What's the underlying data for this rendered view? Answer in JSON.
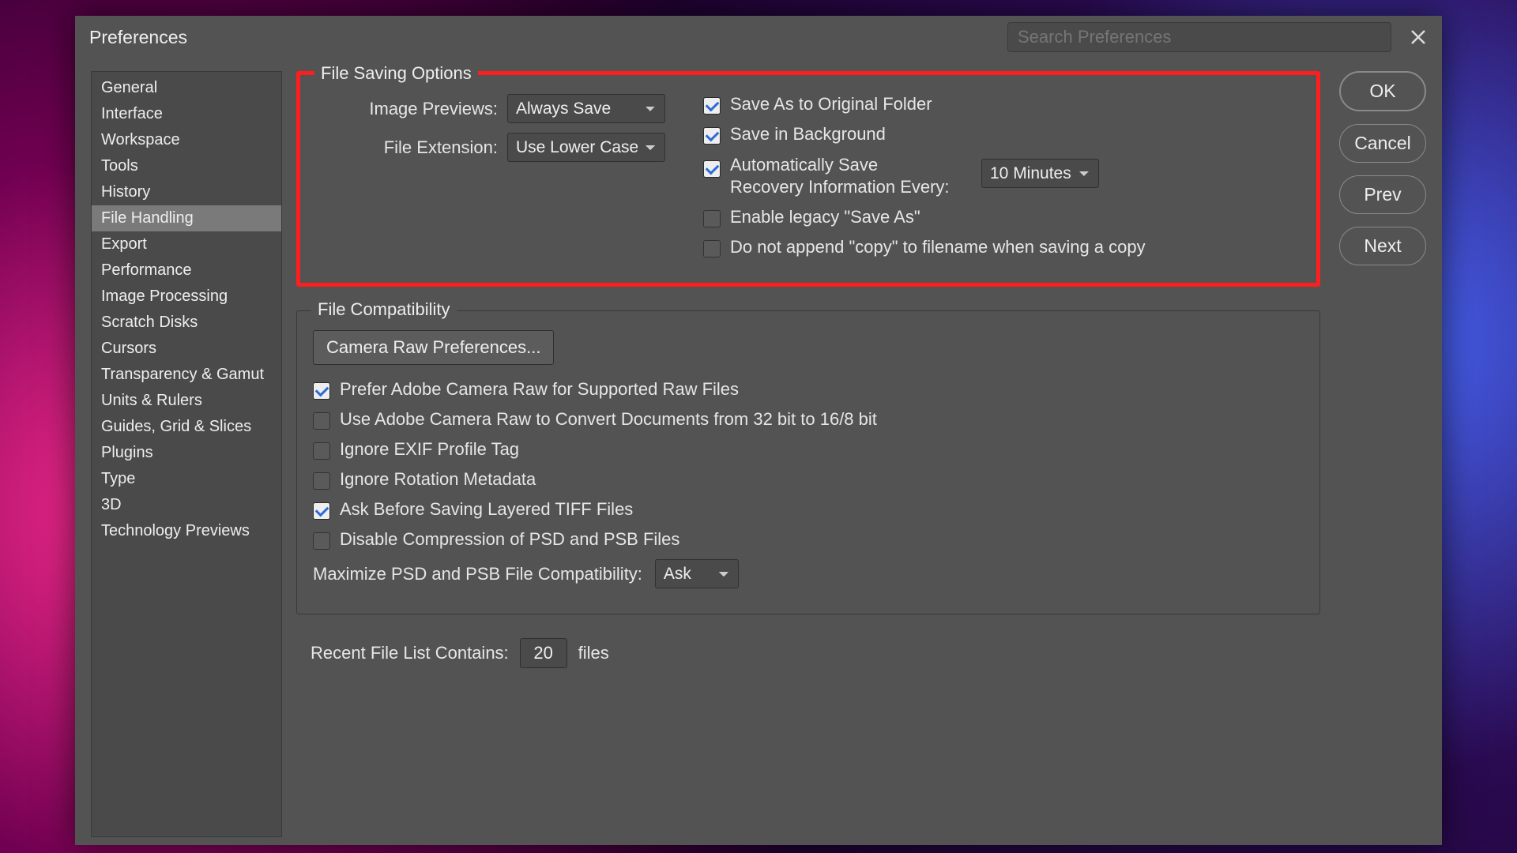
{
  "dialog": {
    "title": "Preferences"
  },
  "search": {
    "placeholder": "Search Preferences"
  },
  "sidebar": {
    "items": [
      "General",
      "Interface",
      "Workspace",
      "Tools",
      "History",
      "File Handling",
      "Export",
      "Performance",
      "Image Processing",
      "Scratch Disks",
      "Cursors",
      "Transparency & Gamut",
      "Units & Rulers",
      "Guides, Grid & Slices",
      "Plugins",
      "Type",
      "3D",
      "Technology Previews"
    ],
    "active_index": 5
  },
  "file_saving": {
    "legend": "File Saving Options",
    "image_previews_label": "Image Previews:",
    "image_previews_value": "Always Save",
    "file_extension_label": "File Extension:",
    "file_extension_value": "Use Lower Case",
    "save_as_original": "Save As to Original Folder",
    "save_in_background": "Save in Background",
    "autosave_label": "Automatically Save Recovery Information Every:",
    "autosave_interval": "10 Minutes",
    "enable_legacy": "Enable legacy \"Save As\"",
    "no_append_copy": "Do not append \"copy\" to filename when saving a copy"
  },
  "file_compat": {
    "legend": "File Compatibility",
    "camera_raw_btn": "Camera Raw Preferences...",
    "prefer_acr": "Prefer Adobe Camera Raw for Supported Raw Files",
    "use_acr_convert": "Use Adobe Camera Raw to Convert Documents from 32 bit to 16/8 bit",
    "ignore_exif": "Ignore EXIF Profile Tag",
    "ignore_rotation": "Ignore Rotation Metadata",
    "ask_tiff": "Ask Before Saving Layered TIFF Files",
    "disable_compress": "Disable Compression of PSD and PSB Files",
    "maximize_label": "Maximize PSD and PSB File Compatibility:",
    "maximize_value": "Ask"
  },
  "recent": {
    "label": "Recent File List Contains:",
    "value": "20",
    "suffix": "files"
  },
  "buttons": {
    "ok": "OK",
    "cancel": "Cancel",
    "prev": "Prev",
    "next": "Next"
  }
}
